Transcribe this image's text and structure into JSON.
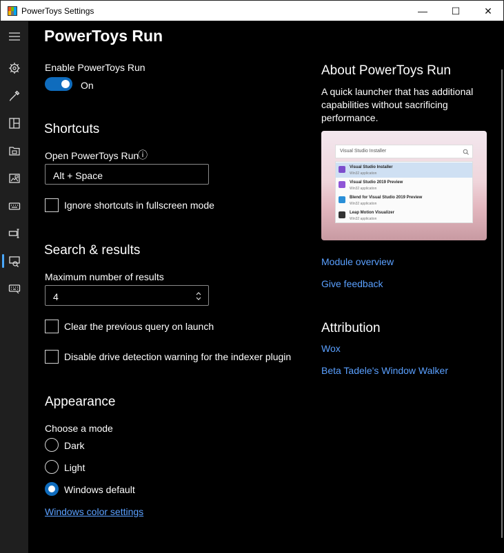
{
  "window": {
    "title": "PowerToys Settings",
    "minimize_glyph": "—",
    "maximize_glyph": "☐",
    "close_glyph": "✕"
  },
  "rail": {
    "items": [
      {
        "icon": "hamburger-menu-icon"
      },
      {
        "icon": "gear-icon"
      },
      {
        "icon": "color-picker-icon"
      },
      {
        "icon": "fancyzones-icon"
      },
      {
        "icon": "file-explorer-icon"
      },
      {
        "icon": "image-resizer-icon"
      },
      {
        "icon": "keyboard-icon"
      },
      {
        "icon": "power-rename-icon"
      },
      {
        "icon": "powertoys-run-icon"
      },
      {
        "icon": "shortcut-guide-icon"
      }
    ],
    "selected_index": 8,
    "accent": "#4aa8ff"
  },
  "page": {
    "title": "PowerToys Run",
    "enable_label": "Enable PowerToys Run",
    "toggle_state": "On",
    "shortcuts": {
      "heading": "Shortcuts",
      "open_label": "Open PowerToys Run",
      "info_glyph": "ⓘ",
      "open_value": "Alt + Space",
      "ignore_fullscreen_label": "Ignore shortcuts in fullscreen mode"
    },
    "search": {
      "heading": "Search & results",
      "max_results_label": "Maximum number of results",
      "max_results_value": "4",
      "clear_query_label": "Clear the previous query on launch",
      "disable_drive_label": "Disable drive detection warning for the indexer plugin"
    },
    "appearance": {
      "heading": "Appearance",
      "mode_label": "Choose a mode",
      "options": [
        "Dark",
        "Light",
        "Windows default"
      ],
      "selected": "Windows default",
      "color_settings_link": "Windows color settings"
    }
  },
  "about": {
    "title": "About PowerToys Run",
    "description": "A quick launcher that has additional capabilities without sacrificing performance.",
    "preview": {
      "search_text": "Visual Studio Installer",
      "results": [
        {
          "title": "Visual Studio Installer",
          "subtitle": "Win32 application",
          "color": "#7c4dcc"
        },
        {
          "title": "Visual Studio 2019 Preview",
          "subtitle": "Win32 application",
          "color": "#8f55d6"
        },
        {
          "title": "Blend for Visual Studio 2019 Preview",
          "subtitle": "Win32 application",
          "color": "#2a8fd8"
        },
        {
          "title": "Leap Motion Visualizer",
          "subtitle": "Win32 application",
          "color": "#333333"
        }
      ]
    },
    "module_overview_link": "Module overview",
    "give_feedback_link": "Give feedback",
    "attribution_heading": "Attribution",
    "attribution_links": [
      "Wox",
      "Beta Tadele's Window Walker"
    ]
  },
  "colors": {
    "accent": "#0f6cbd",
    "link": "#5aa0ff",
    "background": "#000000",
    "rail_background": "#1f1f1f"
  }
}
